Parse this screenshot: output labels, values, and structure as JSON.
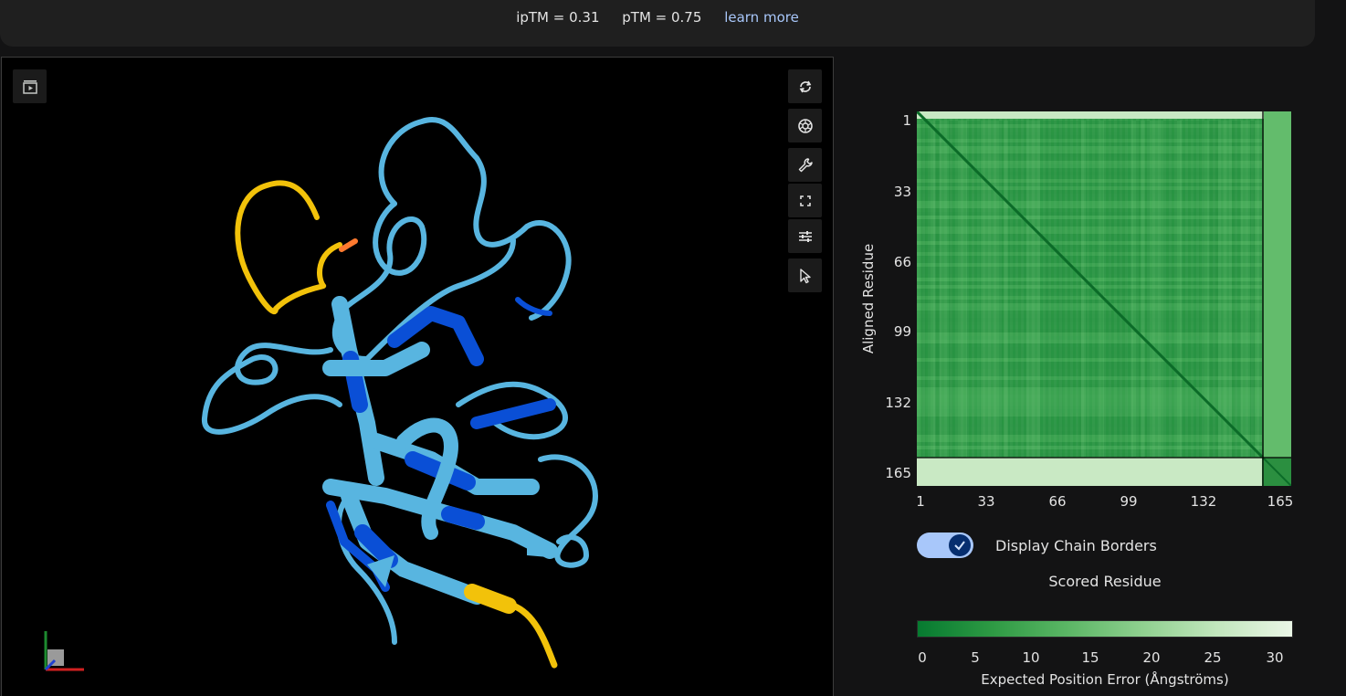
{
  "header": {
    "iptm": "ipTM = 0.31",
    "ptm": "pTM = 0.75",
    "learn_more": "learn more"
  },
  "viewer": {
    "toolbar": [
      {
        "icon": "play-sequence-icon"
      },
      {
        "icon": "rotate-icon"
      },
      {
        "icon": "camera-aperture-icon"
      },
      {
        "icon": "wrench-icon"
      },
      {
        "icon": "fullscreen-icon"
      },
      {
        "icon": "sliders-icon"
      },
      {
        "icon": "cursor-icon"
      }
    ],
    "colors": {
      "chain_a_high": "#58b5e0",
      "chain_a_very_high": "#0a4fd6",
      "chain_b_low": "#f2c20a",
      "ligand": "#ff7a2f"
    }
  },
  "pae": {
    "y_label": "Aligned Residue",
    "y_ticks": [
      "1",
      "33",
      "66",
      "99",
      "132",
      "165"
    ],
    "x_ticks": [
      "1",
      "33",
      "66",
      "99",
      "132",
      "165"
    ],
    "x_label": "Scored Residue",
    "chain_border_residue": 152,
    "toggle_label": "Display Chain Borders",
    "toggle_on": true,
    "colorbar_ticks": [
      "0",
      "5",
      "10",
      "15",
      "20",
      "25",
      "30"
    ],
    "colorbar_title": "Expected Position Error (Ångströms)",
    "colors": {
      "low": "#067a30",
      "high": "#eaf6e6"
    }
  }
}
